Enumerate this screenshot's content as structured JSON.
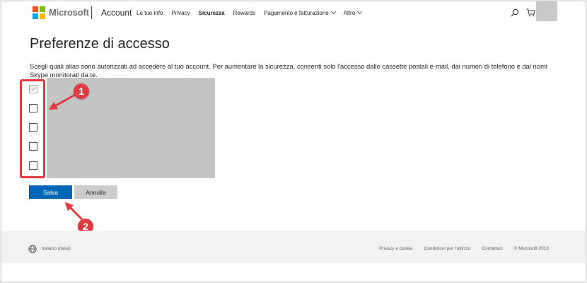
{
  "header": {
    "brand": "Microsoft",
    "account_label": "Account",
    "nav": [
      {
        "label": "Le tue info"
      },
      {
        "label": "Privacy"
      },
      {
        "label": "Sicurezza",
        "active": true
      },
      {
        "label": "Rewards"
      },
      {
        "label": "Pagamento e fatturazione",
        "dropdown": true
      },
      {
        "label": "Altro",
        "dropdown": true
      }
    ],
    "icons": [
      "search-icon",
      "cart-icon"
    ]
  },
  "main": {
    "title": "Preferenze di accesso",
    "description": "Scegli quali alias sono autorizzati ad accedere al tuo account. Per aumentare la sicurezza, consenti solo l'accesso dalle cassette postali e-mail, dai numeri di telefono e dai nomi Skype monitorati da te.",
    "aliases": [
      {
        "checked": true,
        "disabled": true
      },
      {
        "checked": false,
        "disabled": false
      },
      {
        "checked": false,
        "disabled": false
      },
      {
        "checked": false,
        "disabled": false
      },
      {
        "checked": false,
        "disabled": false
      }
    ],
    "save_label": "Salva",
    "cancel_label": "Annulla"
  },
  "annotations": {
    "callout_1": "1",
    "callout_2": "2",
    "color": "#e0393e"
  },
  "footer": {
    "locale": "Italiano (Italia)",
    "links": [
      "Privacy e cookie",
      "Condizioni per l'utilizzo",
      "Contattaci"
    ],
    "copyright": "© Microsoft 2018"
  },
  "colors": {
    "accent": "#0067b8",
    "logo_red": "#f25022",
    "logo_green": "#7fba00",
    "logo_blue": "#00a4ef",
    "logo_yellow": "#ffb900"
  }
}
